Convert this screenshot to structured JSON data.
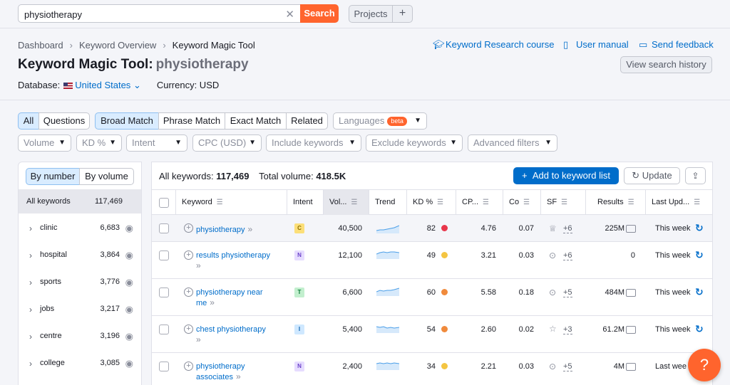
{
  "search": {
    "value": "physiotherapy",
    "button": "Search"
  },
  "header": {
    "projects_label": "Projects",
    "plus_label": "+"
  },
  "breadcrumb": [
    "Dashboard",
    "Keyword Overview",
    "Keyword Magic Tool"
  ],
  "top_links": {
    "course": "Keyword Research course",
    "manual": "User manual",
    "feedback": "Send feedback"
  },
  "page": {
    "title": "Keyword Magic Tool:",
    "keyword": "physiotherapy",
    "history_button": "View search history",
    "database_label": "Database:",
    "database_value": "United States",
    "currency": "Currency: USD"
  },
  "tabs": {
    "scope": [
      "All",
      "Questions"
    ],
    "match": [
      "Broad Match",
      "Phrase Match",
      "Exact Match",
      "Related"
    ],
    "languages": "Languages",
    "beta": "beta"
  },
  "filters": [
    "Volume",
    "KD %",
    "Intent",
    "CPC (USD)",
    "Include keywords",
    "Exclude keywords",
    "Advanced filters"
  ],
  "sidebar": {
    "by_number": "By number",
    "by_volume": "By volume",
    "all_label": "All keywords",
    "all_count": "117,469",
    "items": [
      {
        "label": "clinic",
        "count": "6,683"
      },
      {
        "label": "hospital",
        "count": "3,864"
      },
      {
        "label": "sports",
        "count": "3,776"
      },
      {
        "label": "jobs",
        "count": "3,217"
      },
      {
        "label": "centre",
        "count": "3,196"
      },
      {
        "label": "college",
        "count": "3,085"
      }
    ]
  },
  "table": {
    "all_keywords_label": "All keywords:",
    "all_keywords_value": "117,469",
    "total_volume_label": "Total volume:",
    "total_volume_value": "418.5K",
    "add_button": "Add to keyword list",
    "update_button": "Update",
    "columns": [
      "Keyword",
      "Intent",
      "Vol...",
      "Trend",
      "KD %",
      "CP...",
      "Co",
      "SF",
      "Results",
      "Last Upd..."
    ],
    "rows": [
      {
        "keyword": "physiotherapy",
        "keyword2": "",
        "intent": "C",
        "volume": "40,500",
        "kd": "82",
        "kd_color": "#e8364b",
        "cpc": "4.76",
        "com": "0.07",
        "sf": "+6",
        "results": "225M",
        "updated": "This week"
      },
      {
        "keyword": "results physiotherapy",
        "keyword2": "",
        "intent": "N",
        "volume": "12,100",
        "kd": "49",
        "kd_color": "#f4c542",
        "cpc": "3.21",
        "com": "0.03",
        "sf": "+6",
        "results": "0",
        "updated": "This week"
      },
      {
        "keyword": "physiotherapy near",
        "keyword2": "me",
        "intent": "T",
        "volume": "6,600",
        "kd": "60",
        "kd_color": "#f08a3c",
        "cpc": "5.58",
        "com": "0.18",
        "sf": "+5",
        "results": "484M",
        "updated": "This week"
      },
      {
        "keyword": "chest physiotherapy",
        "keyword2": "",
        "intent": "I",
        "volume": "5,400",
        "kd": "54",
        "kd_color": "#f08a3c",
        "cpc": "2.60",
        "com": "0.02",
        "sf": "+3",
        "results": "61.2M",
        "updated": "This week"
      },
      {
        "keyword": "physiotherapy",
        "keyword2": "associates",
        "intent": "N",
        "volume": "2,400",
        "kd": "34",
        "kd_color": "#f4c542",
        "cpc": "2.21",
        "com": "0.03",
        "sf": "+5",
        "results": "4M",
        "updated": "Last wee"
      }
    ]
  },
  "help_label": "?"
}
